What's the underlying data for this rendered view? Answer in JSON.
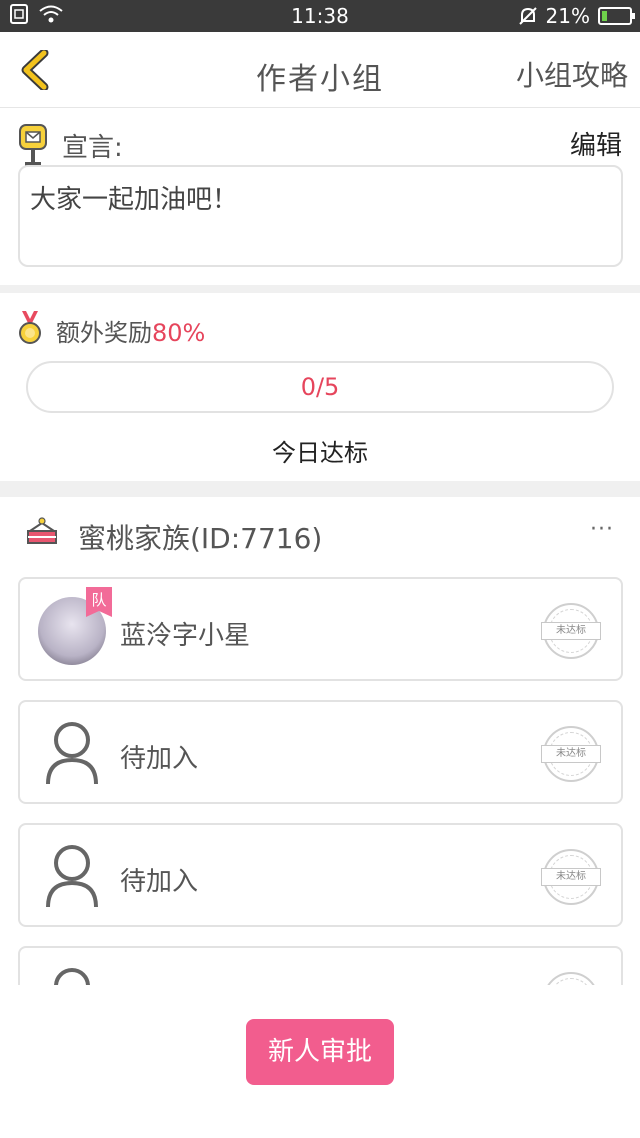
{
  "status_bar": {
    "time": "11:38",
    "battery_percent": "21%",
    "battery_level": 0.21
  },
  "header": {
    "title": "作者小组",
    "action": "小组攻略"
  },
  "declaration": {
    "label": "宣言:",
    "edit_label": "编辑",
    "text": "大家一起加油吧！"
  },
  "reward": {
    "label": "额外奖励",
    "percent": "80%",
    "progress_text": "0/5",
    "progress_fraction": 0,
    "today_label": "今日达标"
  },
  "group": {
    "name": "蜜桃家族(ID:7716)",
    "more": "···"
  },
  "members": [
    {
      "name": "蓝泠字小星",
      "badge": "队",
      "status": "未达标",
      "has_avatar": true
    },
    {
      "name": "待加入",
      "status": "未达标",
      "has_avatar": false
    },
    {
      "name": "待加入",
      "status": "未达标",
      "has_avatar": false
    },
    {
      "name": "",
      "status": "",
      "has_avatar": false
    }
  ],
  "approve_button": "新人审批",
  "colors": {
    "accent_pink": "#f25d8e",
    "progress_text": "#e6455c",
    "back_arrow": "#f2c21d"
  }
}
